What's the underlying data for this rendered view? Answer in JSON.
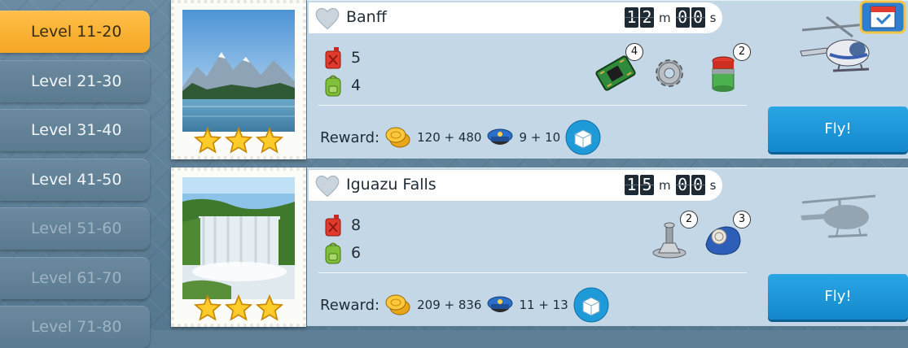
{
  "sidebar": {
    "items": [
      {
        "label": "Level 11-20",
        "state": "active"
      },
      {
        "label": "Level 21-30",
        "state": "unlocked"
      },
      {
        "label": "Level 31-40",
        "state": "unlocked"
      },
      {
        "label": "Level 41-50",
        "state": "unlocked"
      },
      {
        "label": "Level 51-60",
        "state": "locked"
      },
      {
        "label": "Level 61-70",
        "state": "locked"
      },
      {
        "label": "Level 71-80",
        "state": "locked"
      }
    ]
  },
  "levels": [
    {
      "name": "Banff",
      "stars": 3,
      "timer": {
        "h1": "1",
        "h2": "2",
        "unit_m": "m",
        "s1": "0",
        "s2": "0",
        "unit_s": "s"
      },
      "fuel": "5",
      "bags": "4",
      "parts": [
        {
          "icon": "circuit-board-icon",
          "count": "4"
        },
        {
          "icon": "gear-icon",
          "count": ""
        },
        {
          "icon": "paint-can-icon",
          "count": "2"
        }
      ],
      "reward": {
        "label": "Reward:",
        "coins": "120 + 480",
        "xp": "9 + 10"
      },
      "fly_label": "Fly!",
      "helicopter_unlocked": true
    },
    {
      "name": "Iguazu Falls",
      "stars": 3,
      "timer": {
        "h1": "1",
        "h2": "5",
        "unit_m": "m",
        "s1": "0",
        "s2": "0",
        "unit_s": "s"
      },
      "fuel": "8",
      "bags": "6",
      "parts": [
        {
          "icon": "joystick-icon",
          "count": "2"
        },
        {
          "icon": "rope-bundle-icon",
          "count": "3"
        }
      ],
      "reward": {
        "label": "Reward:",
        "coins": "209 + 836",
        "xp": "11 + 13"
      },
      "fly_label": "Fly!",
      "helicopter_unlocked": false
    }
  ],
  "colors": {
    "active_tab": "#f5a623",
    "fly_button": "#1a95d8",
    "panel": "#c4d7e6"
  }
}
